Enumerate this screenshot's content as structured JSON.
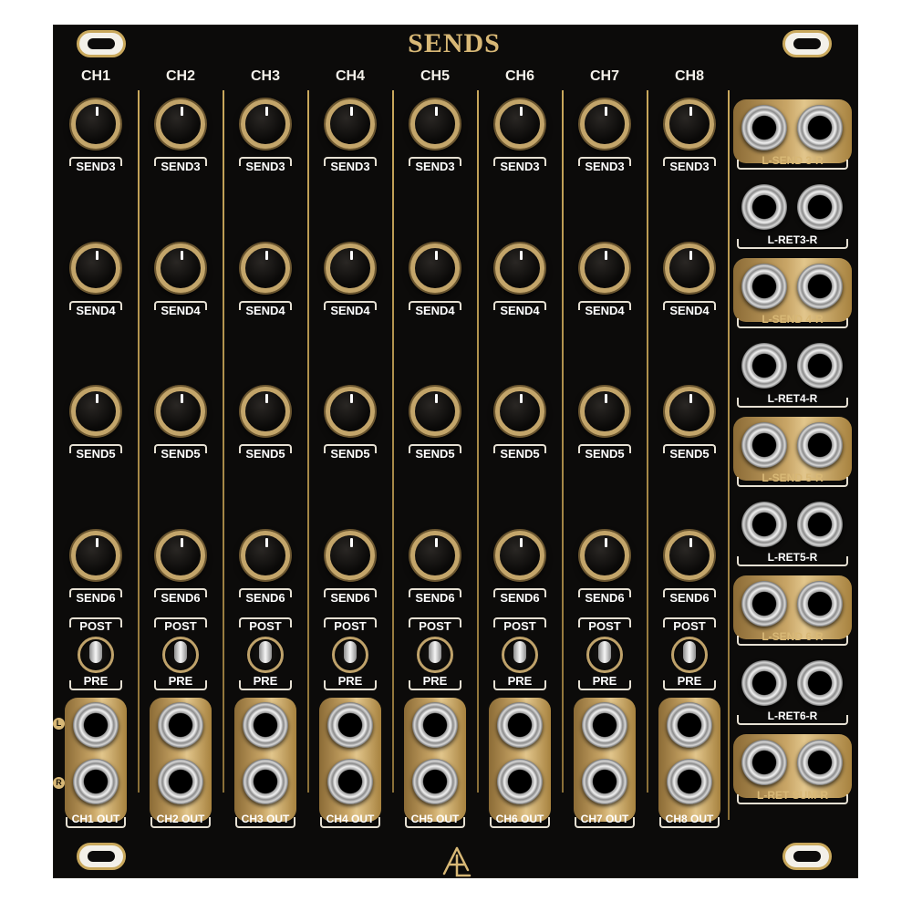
{
  "module": {
    "title": "SENDS",
    "brand_logo_icon": "al-logo-icon"
  },
  "channels": [
    {
      "name": "CH1",
      "out_label": "CH1 OUT"
    },
    {
      "name": "CH2",
      "out_label": "CH2 OUT"
    },
    {
      "name": "CH3",
      "out_label": "CH3 OUT"
    },
    {
      "name": "CH4",
      "out_label": "CH4 OUT"
    },
    {
      "name": "CH5",
      "out_label": "CH5 OUT"
    },
    {
      "name": "CH6",
      "out_label": "CH6 OUT"
    },
    {
      "name": "CH7",
      "out_label": "CH7 OUT"
    },
    {
      "name": "CH8",
      "out_label": "CH8 OUT"
    }
  ],
  "send_knobs": [
    "SEND3",
    "SEND4",
    "SEND5",
    "SEND6"
  ],
  "toggle": {
    "top_label": "POST",
    "bottom_label": "PRE"
  },
  "output_jacks": {
    "left_label": "L",
    "right_label": "R"
  },
  "return_section": [
    {
      "label": "L-SEND 3-R",
      "style": "gold"
    },
    {
      "label": "L-RET3-R",
      "style": "plain"
    },
    {
      "label": "L-SEND 4-R",
      "style": "gold"
    },
    {
      "label": "L-RET4-R",
      "style": "plain"
    },
    {
      "label": "L-SEND 5-R",
      "style": "gold"
    },
    {
      "label": "L-RET5-R",
      "style": "plain"
    },
    {
      "label": "L-SEND 6-R",
      "style": "gold"
    },
    {
      "label": "L-RET6-R",
      "style": "plain"
    },
    {
      "label": "L-RET SUM-R",
      "style": "gold"
    }
  ],
  "colors": {
    "panel": "#0c0b0a",
    "gold_accent": "#d8b876",
    "label_text": "#ffffff"
  }
}
